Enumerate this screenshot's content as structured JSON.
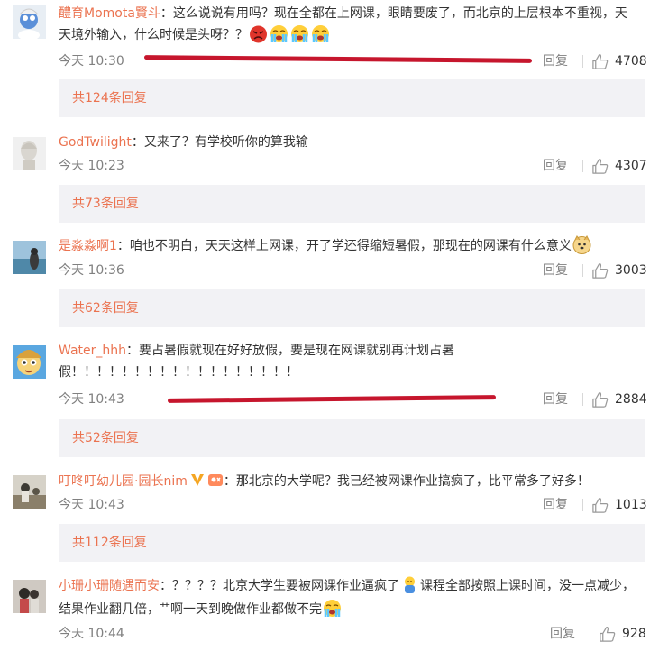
{
  "comments": [
    {
      "username": "醴育Momota賢斗",
      "separator": "：",
      "text_a": "这么说说有用吗？现在全都在上网课，眼睛要废了，而北京的上层根本不重视，天天境外输入，什么时候是头呀？？",
      "text_b": "",
      "time": "今天 10:30",
      "reply_label": "回复",
      "likes": "4708",
      "sub_replies": "共124条回复",
      "emojis_end": [
        "angry-emoji",
        "crying-emoji",
        "crying-emoji",
        "crying-emoji"
      ]
    },
    {
      "username": "GodTwilight",
      "separator": "：",
      "text_a": "又来了？有学校听你的算我输",
      "time": "今天 10:23",
      "reply_label": "回复",
      "likes": "4307",
      "sub_replies": "共73条回复"
    },
    {
      "username": "是淼淼啊1",
      "separator": "：",
      "text_a": "咱也不明白，天天这样上网课，开了学还得缩短暑假，那现在的网课有什么意义",
      "time": "今天 10:36",
      "reply_label": "回复",
      "likes": "3003",
      "sub_replies": "共62条回复",
      "emojis_end": [
        "doge-emoji"
      ]
    },
    {
      "username": "Water_hhh",
      "separator": "：",
      "text_a": "要占暑假就现在好好放假，要是现在网课就别再计划占暑假！！！！！！！！！！！！！！！！！！",
      "time": "今天 10:43",
      "reply_label": "回复",
      "likes": "2884",
      "sub_replies": "共52条回复"
    },
    {
      "username": "叮咚叮幼儿园·园长nim",
      "separator": "：",
      "text_a": "那北京的大学呢？我已经被网课作业搞疯了，比平常多了好多！",
      "time": "今天 10:43",
      "reply_label": "回复",
      "likes": "1013",
      "sub_replies": "共112条回复",
      "badges": [
        "vip-v-badge",
        "fan-badge"
      ]
    },
    {
      "username": "小珊小珊随遇而安",
      "separator": "：",
      "text_a": "？？？？北京大学生要被网课作业逼疯了",
      "text_b": "课程全部按照上课时间，没一点减少，结果作业翻几倍，",
      "text_c": "啊一天到晚做作业都做不完",
      "time": "今天 10:44",
      "reply_label": "回复",
      "likes": "928",
      "glyph_c": "艹",
      "emojis_mid": [
        "tired-emoji"
      ],
      "emojis_end": [
        "crying-emoji"
      ]
    }
  ]
}
